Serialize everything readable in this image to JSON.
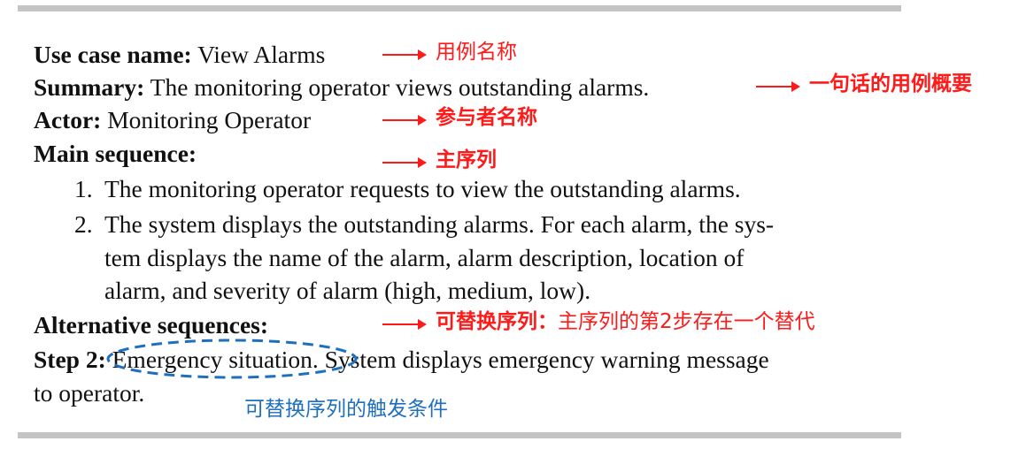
{
  "spec": {
    "use_case_name_label": "Use case name:",
    "use_case_name_value": "View Alarms",
    "summary_label": "Summary:",
    "summary_value": "The monitoring operator views outstanding alarms.",
    "actor_label": "Actor:",
    "actor_value": "Monitoring Operator",
    "main_sequence_label": "Main sequence:",
    "steps": [
      {
        "num": "1.",
        "lines": [
          "The monitoring operator requests to view the outstanding alarms."
        ]
      },
      {
        "num": "2.",
        "lines": [
          "The system displays the outstanding alarms. For each alarm, the sys-",
          "tem displays the name of the alarm, alarm description, location of",
          "alarm, and severity of alarm (high, medium, low)."
        ]
      }
    ],
    "alternative_label": "Alternative sequences:",
    "alt_step_label": "Step 2:",
    "alt_step_text_1": "Emergency situation. System displays emergency warning message",
    "alt_step_text_2": "to operator."
  },
  "annotations": {
    "use_case_name": "用例名称",
    "summary": "一句话的用例概要",
    "actor": "参与者名称",
    "main_sequence": "主序列",
    "alternative_bold": "可替换序列：",
    "alternative_rest": "主序列的第2步存在一个替代",
    "trigger": "可替换序列的触发条件"
  },
  "colors": {
    "annotation_red": "#ff1a1a",
    "annotation_blue": "#1f6fbf",
    "rule_gray": "#c4c4c4"
  }
}
